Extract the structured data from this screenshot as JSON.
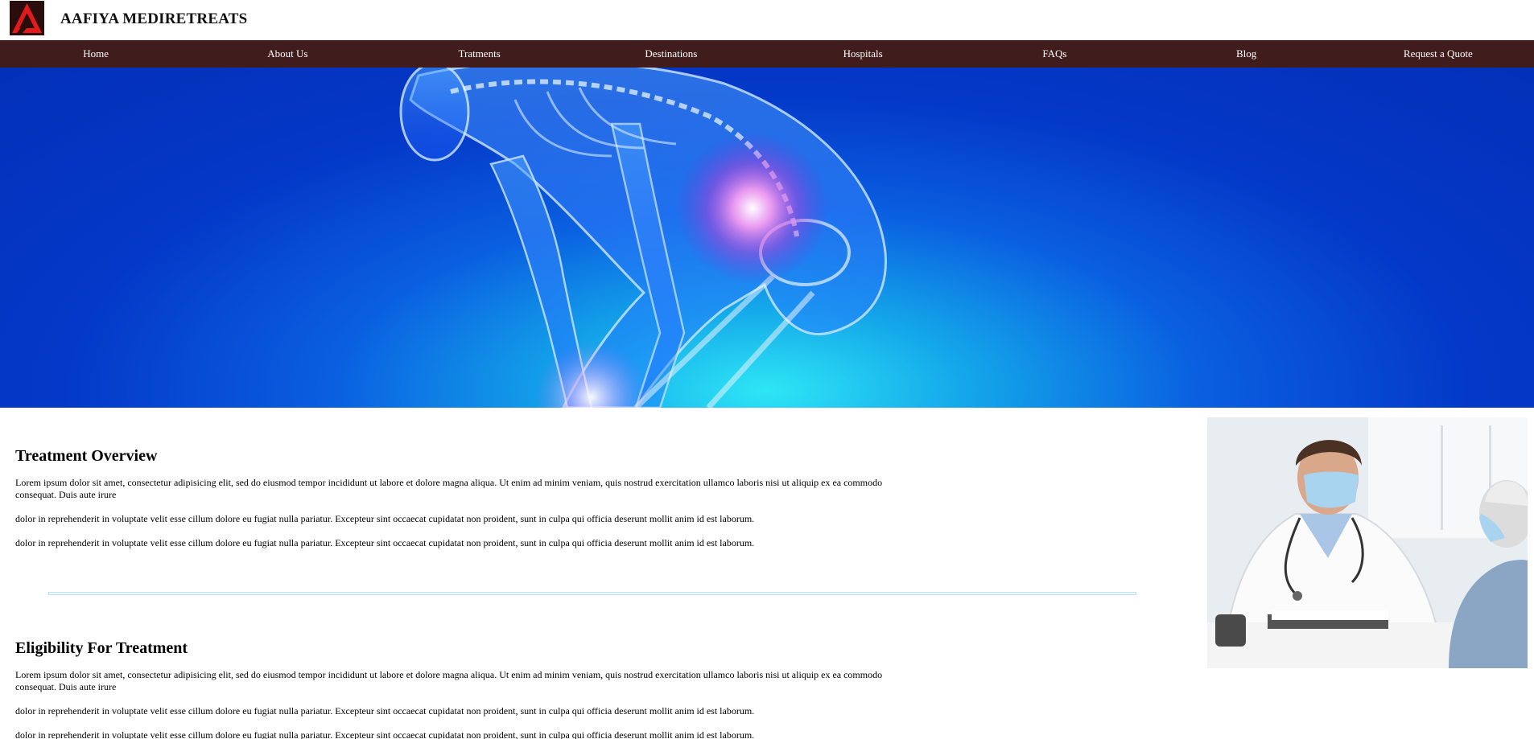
{
  "brand": {
    "name": "AAFIYA MEDIRETREATS",
    "logo_icon": "triangle-logo-icon",
    "colors": {
      "nav_bg": "#411c1c",
      "logo_red": "#e11b1b",
      "hero_blue": "#0438c8"
    }
  },
  "nav": {
    "items": [
      {
        "label": "Home"
      },
      {
        "label": "About Us"
      },
      {
        "label": "Tratments"
      },
      {
        "label": "Destinations"
      },
      {
        "label": "Hospitals"
      },
      {
        "label": "FAQs"
      },
      {
        "label": "Blog"
      },
      {
        "label": "Request a Quote"
      }
    ]
  },
  "sections": [
    {
      "title": "Treatment Overview",
      "paragraphs": [
        "Lorem ipsum dolor sit amet, consectetur adipisicing elit, sed do eiusmod tempor incididunt ut labore et dolore magna aliqua. Ut enim ad minim veniam, quis nostrud exercitation ullamco laboris nisi ut aliquip ex ea commodo consequat. Duis aute irure",
        "dolor in reprehenderit in voluptate velit esse cillum dolore eu fugiat nulla pariatur. Excepteur sint occaecat cupidatat non proident, sunt in culpa qui officia deserunt mollit anim id est laborum.",
        "dolor in reprehenderit in voluptate velit esse cillum dolore eu fugiat nulla pariatur. Excepteur sint occaecat cupidatat non proident, sunt in culpa qui officia deserunt mollit anim id est laborum."
      ]
    },
    {
      "title": "Eligibility For Treatment",
      "paragraphs": [
        "Lorem ipsum dolor sit amet, consectetur adipisicing elit, sed do eiusmod tempor incididunt ut labore et dolore magna aliqua. Ut enim ad minim veniam, quis nostrud exercitation ullamco laboris nisi ut aliquip ex ea commodo consequat. Duis aute irure",
        "dolor in reprehenderit in voluptate velit esse cillum dolore eu fugiat nulla pariatur. Excepteur sint occaecat cupidatat non proident, sunt in culpa qui officia deserunt mollit anim id est laborum.",
        "dolor in reprehenderit in voluptate velit esse cillum dolore eu fugiat nulla pariatur. Excepteur sint occaecat cupidatat non proident, sunt in culpa qui officia deserunt mollit anim id est laborum."
      ]
    }
  ]
}
